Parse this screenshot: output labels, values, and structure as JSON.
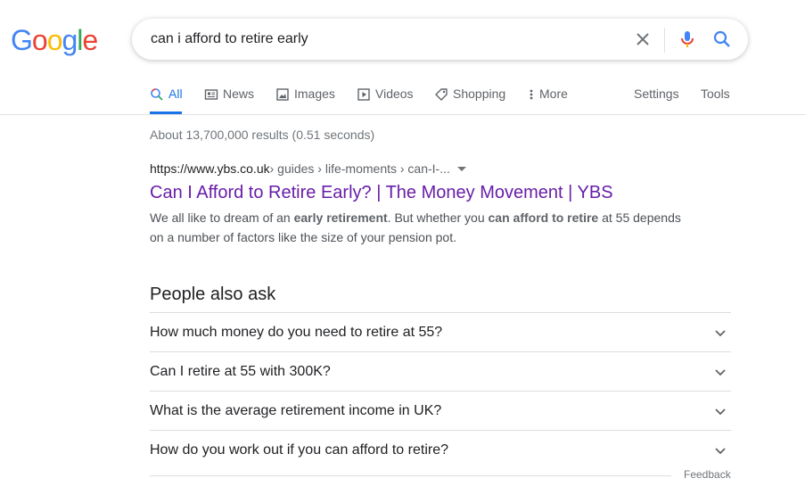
{
  "logo": {
    "letters": [
      {
        "char": "G",
        "color": "#4285F4"
      },
      {
        "char": "o",
        "color": "#EA4335"
      },
      {
        "char": "o",
        "color": "#FBBC05"
      },
      {
        "char": "g",
        "color": "#4285F4"
      },
      {
        "char": "l",
        "color": "#34A853"
      },
      {
        "char": "e",
        "color": "#EA4335"
      }
    ]
  },
  "search": {
    "query": "can i afford to retire early",
    "clear_icon": "close-icon",
    "mic_icon": "microphone-icon",
    "search_icon": "search-icon"
  },
  "tabs": [
    {
      "label": "All",
      "icon": "search-icon",
      "active": true
    },
    {
      "label": "News",
      "icon": "news-icon"
    },
    {
      "label": "Images",
      "icon": "image-icon"
    },
    {
      "label": "Videos",
      "icon": "video-icon"
    },
    {
      "label": "Shopping",
      "icon": "tag-icon"
    },
    {
      "label": "More",
      "icon": "more-vert-icon"
    }
  ],
  "tools": {
    "settings": "Settings",
    "tools": "Tools"
  },
  "stats": "About 13,700,000 results (0.51 seconds)",
  "result": {
    "cite_domain": "https://www.ybs.co.uk",
    "cite_path": " › guides › life-moments › can-I-...",
    "title": "Can I Afford to Retire Early? | The Money Movement | YBS",
    "snippet": [
      {
        "text": "We all like to dream of an ",
        "bold": false
      },
      {
        "text": "early retirement",
        "bold": true
      },
      {
        "text": ". But whether you ",
        "bold": false
      },
      {
        "text": "can afford to retire",
        "bold": true
      },
      {
        "text": " at 55 depends on a number of factors like the size of your pension pot.",
        "bold": false
      }
    ]
  },
  "people_also_ask": {
    "heading": "People also ask",
    "questions": [
      "How much money do you need to retire at 55?",
      "Can I retire at 55 with 300K?",
      "What is the average retirement income in UK?",
      "How do you work out if you can afford to retire?"
    ]
  },
  "feedback": "Feedback",
  "colors": {
    "link_visited": "#681da8",
    "active_tab": "#1a73e8",
    "muted": "#70757a"
  }
}
